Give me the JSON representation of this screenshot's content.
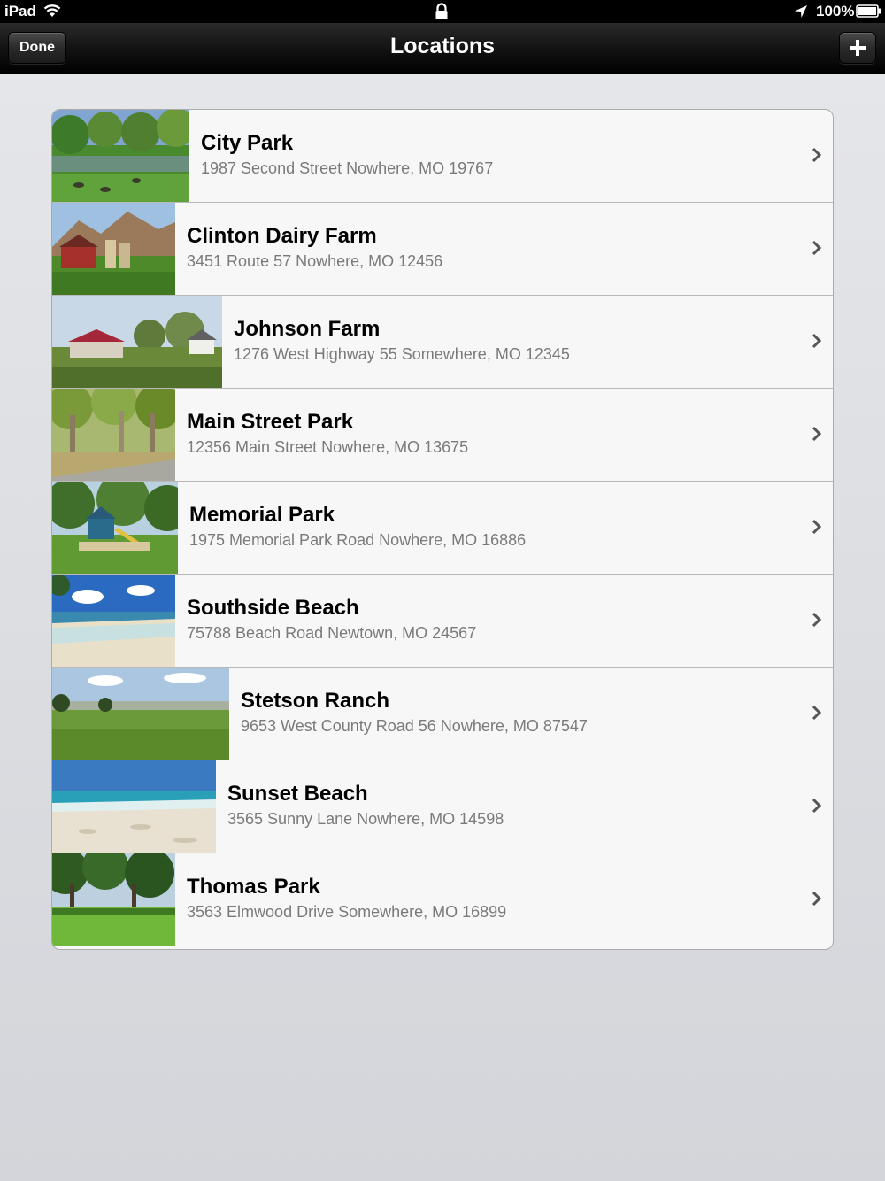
{
  "status_bar": {
    "carrier": "iPad",
    "battery": "100%",
    "icons": [
      "wifi-icon",
      "lock-icon",
      "location-arrow-icon",
      "battery-icon"
    ]
  },
  "nav_bar": {
    "title": "Locations",
    "done_label": "Done",
    "add_icon": "plus-icon"
  },
  "locations": [
    {
      "name": "City Park",
      "address": "1987 Second Street Nowhere, MO 19767",
      "image": "park-pond-photo"
    },
    {
      "name": "Clinton Dairy Farm",
      "address": "3451 Route 57 Nowhere, MO 12456",
      "image": "barn-mountains-photo"
    },
    {
      "name": "Johnson Farm",
      "address": "1276 West Highway 55 Somewhere, MO 12345",
      "image": "farmhouse-photo"
    },
    {
      "name": "Main Street Park",
      "address": "12356 Main Street Nowhere, MO 13675",
      "image": "park-trees-path-photo"
    },
    {
      "name": "Memorial Park",
      "address": "1975 Memorial Park Road Nowhere, MO 16886",
      "image": "playground-photo"
    },
    {
      "name": "Southside Beach",
      "address": "75788 Beach Road Newtown, MO 24567",
      "image": "beach-sky-photo"
    },
    {
      "name": "Stetson Ranch",
      "address": "9653 West County Road 56 Nowhere, MO 87547",
      "image": "ranch-field-photo"
    },
    {
      "name": "Sunset Beach",
      "address": "3565 Sunny Lane Nowhere, MO 14598",
      "image": "sandy-beach-photo"
    },
    {
      "name": "Thomas Park",
      "address": "3563 Elmwood Drive Somewhere, MO 16899",
      "image": "park-lawn-photo"
    }
  ]
}
